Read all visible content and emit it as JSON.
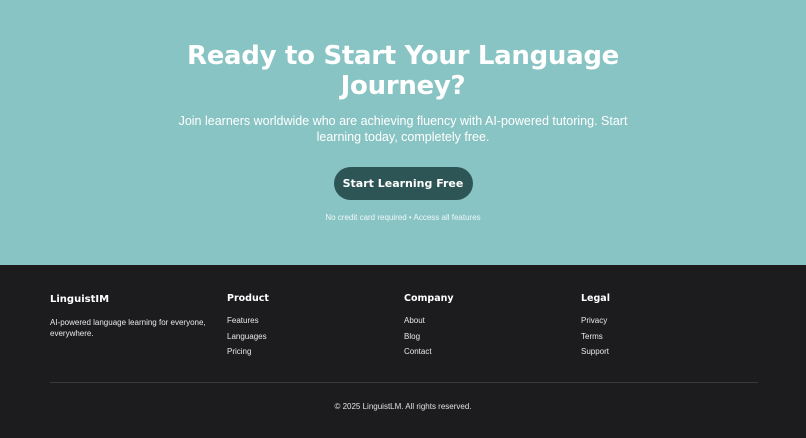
{
  "cta": {
    "title": "Ready to Start Your Language Journey?",
    "subtitle": "Join learners worldwide who are achieving fluency with AI-powered tutoring. Start learning today, completely free.",
    "button_label": "Start Learning Free",
    "note": "No credit card required • Access all features"
  },
  "footer": {
    "brand": {
      "name": "LinguistIM",
      "description": "AI-powered language learning for everyone, everywhere."
    },
    "columns": [
      {
        "title": "Product",
        "links": [
          "Features",
          "Languages",
          "Pricing"
        ]
      },
      {
        "title": "Company",
        "links": [
          "About",
          "Blog",
          "Contact"
        ]
      },
      {
        "title": "Legal",
        "links": [
          "Privacy",
          "Terms",
          "Support"
        ]
      }
    ],
    "copyright": "© 2025 LinguistLM. All rights reserved."
  },
  "colors": {
    "cta_background": "#89c4c4",
    "button_background": "#2e5556",
    "footer_background": "#1c1c1e"
  }
}
